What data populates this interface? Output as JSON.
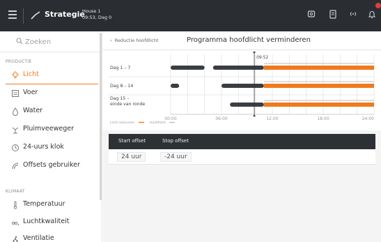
{
  "header": {
    "title": "Strategie",
    "house": "House 1",
    "time_day": "09:53, Dag 0",
    "colors": {
      "background": "#2a2e33",
      "badge": "#e03d3d"
    }
  },
  "sidebar": {
    "search_placeholder": "Zoeken",
    "section_production": "PRODUCTIE",
    "section_climate": "KLIMAAT",
    "production_items": [
      {
        "label": "Licht",
        "icon": "bulb-icon",
        "active": true
      },
      {
        "label": "Voer",
        "icon": "feed-icon"
      },
      {
        "label": "Water",
        "icon": "water-drop-icon"
      },
      {
        "label": "Pluimveeweger",
        "icon": "scale-icon"
      },
      {
        "label": "24-uurs klok",
        "icon": "clock-icon"
      },
      {
        "label": "Offsets gebruiker",
        "icon": "offset-icon"
      }
    ],
    "climate_items": [
      {
        "label": "Temperatuur",
        "icon": "thermometer-icon"
      },
      {
        "label": "Luchtkwaliteit",
        "icon": "co2-icon"
      },
      {
        "label": "Ventilatie",
        "icon": "fan-icon"
      }
    ],
    "accent_color": "#f07a1c"
  },
  "main": {
    "back_label": "Reductie hoofdlicht",
    "title": "Programma hoofdlicht verminderen"
  },
  "chart_data": {
    "type": "timeline",
    "rows": [
      {
        "label": "Dag 1 – 7",
        "dark": [
          [
            0,
            4
          ],
          [
            5,
            11
          ]
        ],
        "orange": [
          [
            11,
            24
          ]
        ]
      },
      {
        "label": "Dag 8 – 14",
        "dark": [
          [
            0,
            1
          ],
          [
            6,
            11
          ]
        ],
        "orange": [
          [
            11,
            24
          ]
        ]
      },
      {
        "label": "Dag 15 – einde van ronde",
        "dark": [
          [
            7,
            11
          ]
        ],
        "orange": [
          [
            11,
            24
          ]
        ]
      }
    ],
    "x_ticks": [
      "00:00",
      "06:00",
      "12:00",
      "18:00",
      "24:00"
    ],
    "xlim": [
      0,
      24
    ],
    "current_time_label": "09:52",
    "current_time_value": 9.87,
    "legend": [
      {
        "name": "Licht reduceren",
        "color": "#f07a1c"
      },
      {
        "name": "Hoofdlicht",
        "color": "#bdbdbd"
      }
    ],
    "colors": {
      "dark": "#3a3e42",
      "orange": "#f07a1c",
      "grid": "#e2e2e2"
    }
  },
  "offsets": {
    "head_start": "Start offset",
    "head_stop": "Stop offset",
    "start_value": "24 uur",
    "stop_value": "-24 uur"
  }
}
